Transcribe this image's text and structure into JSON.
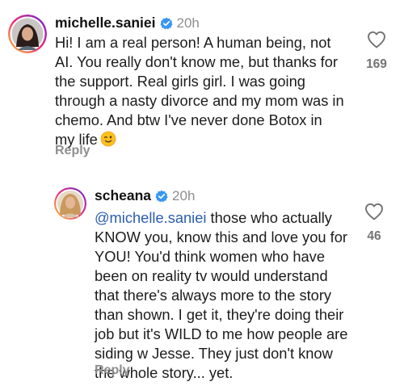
{
  "comments": [
    {
      "username": "michelle.saniei",
      "time": "20h",
      "text": "Hi! I am a real person! A human being, not\nAI.  You really don't know me, but thanks for\nthe support. Real girls girl.  I was going\nthrough a nasty divorce and my mom was in\nchemo.  And btw I've never done Botox in\nmy life",
      "emoji": "winking-face",
      "likes": "169",
      "reply_label": "Reply"
    },
    {
      "username": "scheana",
      "time": "20h",
      "mention": "@michelle.saniei",
      "text": " those who actually\nKNOW you, know this and love you for\nYOU! You'd think women who have\nbeen on reality tv would understand\nthat there's always more to the story\nthan shown. I get it, they're doing their\njob but it's WILD to me how people are\nsiding w Jesse. They just don't know\nthe whole story... yet.",
      "likes": "46",
      "reply_label": "Reply"
    }
  ],
  "colors": {
    "verified": "#3897f0",
    "mention": "#2a5db0",
    "muted": "#8e8e8e"
  },
  "icons": [
    "verified-badge-icon",
    "heart-outline-icon",
    "wink-emoji-icon"
  ]
}
